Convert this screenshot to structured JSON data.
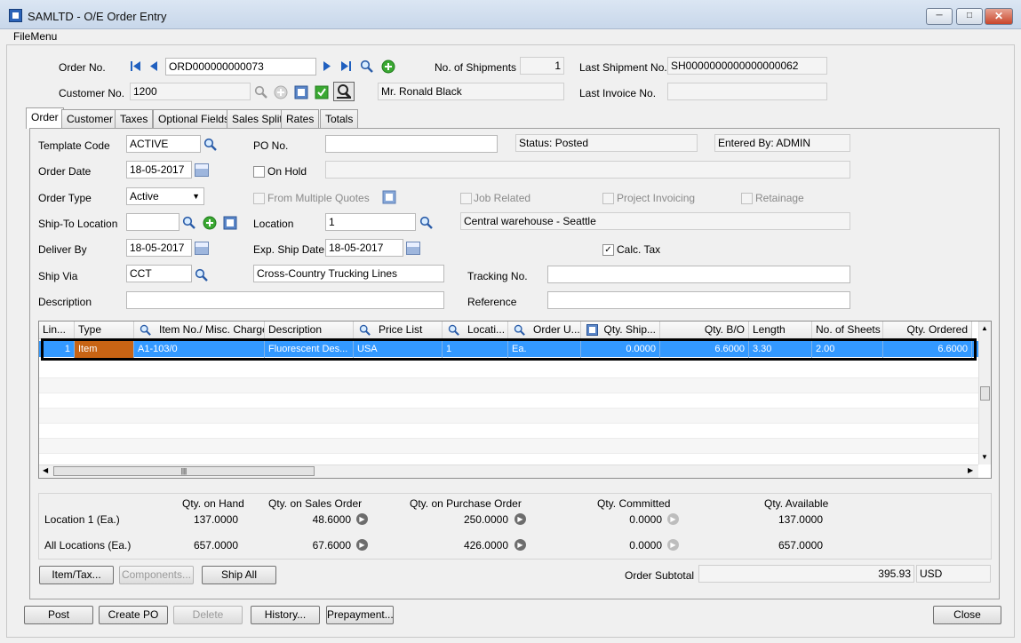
{
  "window": {
    "title": "SAMLTD - O/E Order Entry"
  },
  "menu": {
    "file": "FileMenu"
  },
  "header": {
    "order_no_label": "Order No.",
    "order_no": "ORD000000000073",
    "customer_no_label": "Customer No.",
    "customer_no": "1200",
    "customer_name": "Mr. Ronald Black",
    "shipments_label": "No. of Shipments",
    "shipments": "1",
    "last_shipment_label": "Last Shipment No.",
    "last_shipment": "SH0000000000000000062",
    "last_invoice_label": "Last Invoice No.",
    "last_invoice": ""
  },
  "tabs": [
    "Order",
    "Customer",
    "Taxes",
    "Optional Fields",
    "Sales Split",
    "Rates",
    "Totals"
  ],
  "order": {
    "template_code_label": "Template Code",
    "template_code": "ACTIVE",
    "po_no_label": "PO No.",
    "po_no": "",
    "status": "Status: Posted",
    "entered_by": "Entered By: ADMIN",
    "order_date_label": "Order Date",
    "order_date": "18-05-2017",
    "on_hold_label": "On Hold",
    "order_type_label": "Order Type",
    "order_type": "Active",
    "from_multiple_quotes_label": "From Multiple Quotes",
    "job_related_label": "Job Related",
    "project_invoicing_label": "Project Invoicing",
    "retainage_label": "Retainage",
    "ship_to_label": "Ship-To Location",
    "ship_to": "",
    "location_label": "Location",
    "location": "1",
    "location_desc": "Central warehouse - Seattle",
    "deliver_by_label": "Deliver By",
    "deliver_by": "18-05-2017",
    "exp_ship_label": "Exp. Ship Date",
    "exp_ship": "18-05-2017",
    "calc_tax_label": "Calc. Tax",
    "ship_via_label": "Ship Via",
    "ship_via": "CCT",
    "ship_via_desc": "Cross-Country Trucking Lines",
    "tracking_label": "Tracking No.",
    "tracking": "",
    "description_label": "Description",
    "description": "",
    "reference_label": "Reference",
    "reference": ""
  },
  "grid": {
    "columns": [
      "Lin...",
      "Type",
      "Item No./ Misc. Charge",
      "Description",
      "Price List",
      "Locati...",
      "Order U...",
      "Qty. Ship...",
      "Qty. B/O",
      "Length",
      "No. of Sheets",
      "Qty. Ordered"
    ],
    "rows": [
      [
        "1",
        "Item",
        "A1-103/0",
        "Fluorescent Des...",
        "USA",
        "1",
        "Ea.",
        "0.0000",
        "6.6000",
        "3.30",
        "2.00",
        "6.6000"
      ]
    ]
  },
  "qty": {
    "headers": [
      "Qty. on Hand",
      "Qty. on Sales Order",
      "Qty. on Purchase Order",
      "Qty. Committed",
      "Qty. Available"
    ],
    "rows": [
      {
        "label": "Location  1 (Ea.)",
        "values": [
          "137.0000",
          "48.6000",
          "250.0000",
          "0.0000",
          "137.0000"
        ]
      },
      {
        "label": "All Locations (Ea.)",
        "values": [
          "657.0000",
          "67.6000",
          "426.0000",
          "0.0000",
          "657.0000"
        ]
      }
    ]
  },
  "buttons": {
    "item_tax": "Item/Tax...",
    "components": "Components...",
    "ship_all": "Ship All",
    "post": "Post",
    "create_po": "Create PO",
    "delete": "Delete",
    "history": "History...",
    "prepayment": "Prepayment...",
    "close": "Close"
  },
  "subtotal": {
    "label": "Order Subtotal",
    "value": "395.93",
    "currency": "USD"
  },
  "colors": {
    "selection": "#3399ff",
    "type_cell": "#c86414",
    "titlebar": "#c8d7ea"
  }
}
